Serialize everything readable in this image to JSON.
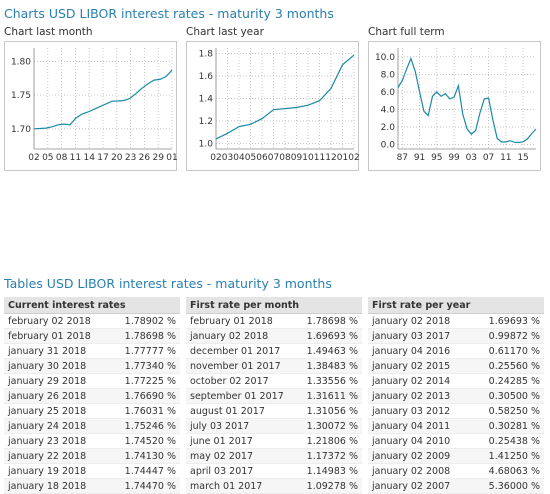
{
  "page": {
    "charts_heading": "Charts USD LIBOR interest rates - maturity 3 months",
    "tables_heading": "Tables USD LIBOR interest rates - maturity 3 months"
  },
  "colors": {
    "heading": "#2a7fb2",
    "line": "#1b8aa6",
    "grid": "#bbbbbb"
  },
  "chart_data": [
    {
      "type": "line",
      "title": "Chart last month",
      "x": [
        "02",
        "03",
        "04",
        "05",
        "08",
        "09",
        "10",
        "11",
        "12",
        "15",
        "16",
        "17",
        "18",
        "19",
        "22",
        "23",
        "24",
        "25",
        "26",
        "29",
        "30",
        "31",
        "01",
        "02"
      ],
      "xticks": [
        "02",
        "05",
        "08",
        "11",
        "14",
        "17",
        "20",
        "23",
        "26",
        "29",
        "01"
      ],
      "ylim": [
        1.67,
        1.82
      ],
      "yticks": [
        {
          "v": 1.7,
          "label": "1.70"
        },
        {
          "v": 1.75,
          "label": "1.75"
        },
        {
          "v": 1.8,
          "label": "1.80"
        }
      ],
      "values": [
        1.7,
        1.7005,
        1.701,
        1.703,
        1.706,
        1.707,
        1.706,
        1.716,
        1.722,
        1.725,
        1.729,
        1.733,
        1.737,
        1.741,
        1.7413,
        1.742,
        1.7452,
        1.7525,
        1.7603,
        1.7669,
        1.7723,
        1.7734,
        1.7777,
        1.787
      ]
    },
    {
      "type": "line",
      "title": "Chart last year",
      "x": [
        "2017-02",
        "2017-03",
        "2017-04",
        "2017-05",
        "2017-06",
        "2017-07",
        "2017-08",
        "2017-09",
        "2017-10",
        "2017-11",
        "2017-12",
        "2018-01",
        "2018-02"
      ],
      "xticks": [
        "02",
        "03",
        "04",
        "05",
        "06",
        "07",
        "08",
        "09",
        "10",
        "11",
        "12",
        "01",
        "02"
      ],
      "ylim": [
        0.95,
        1.85
      ],
      "yticks": [
        {
          "v": 1.0,
          "label": "1.0"
        },
        {
          "v": 1.2,
          "label": "1.2"
        },
        {
          "v": 1.4,
          "label": "1.4"
        },
        {
          "v": 1.6,
          "label": "1.6"
        },
        {
          "v": 1.8,
          "label": "1.8"
        }
      ],
      "values": [
        1.04,
        1.09,
        1.15,
        1.17,
        1.22,
        1.3,
        1.31,
        1.32,
        1.34,
        1.38,
        1.49,
        1.7,
        1.787
      ]
    },
    {
      "type": "line",
      "title": "Chart full term",
      "x": [
        1986,
        1987,
        1988,
        1989,
        1990,
        1991,
        1992,
        1993,
        1994,
        1995,
        1996,
        1997,
        1998,
        1999,
        2000,
        2001,
        2002,
        2003,
        2004,
        2005,
        2006,
        2007,
        2008,
        2009,
        2010,
        2011,
        2012,
        2013,
        2014,
        2015,
        2016,
        2017,
        2018
      ],
      "xticks": [
        {
          "v": 1987,
          "label": "87"
        },
        {
          "v": 1991,
          "label": "91"
        },
        {
          "v": 1995,
          "label": "95"
        },
        {
          "v": 1999,
          "label": "99"
        },
        {
          "v": 2003,
          "label": "03"
        },
        {
          "v": 2007,
          "label": "07"
        },
        {
          "v": 2011,
          "label": "11"
        },
        {
          "v": 2015,
          "label": "15"
        }
      ],
      "ylim": [
        -0.5,
        11
      ],
      "yticks": [
        {
          "v": 0,
          "label": "0.0"
        },
        {
          "v": 2,
          "label": "2.0"
        },
        {
          "v": 4,
          "label": "4.0"
        },
        {
          "v": 6,
          "label": "6.0"
        },
        {
          "v": 8,
          "label": "8.0"
        },
        {
          "v": 10,
          "label": "10.0"
        }
      ],
      "values": [
        6.5,
        7.3,
        8.6,
        9.8,
        8.3,
        6.0,
        3.8,
        3.3,
        5.5,
        6.0,
        5.5,
        5.8,
        5.2,
        5.4,
        6.7,
        3.5,
        1.8,
        1.2,
        1.6,
        3.6,
        5.2,
        5.3,
        2.8,
        0.7,
        0.3,
        0.3,
        0.45,
        0.27,
        0.24,
        0.32,
        0.65,
        1.25,
        1.78
      ]
    }
  ],
  "tables": [
    {
      "header": "Current interest rates",
      "rows": [
        [
          "february 02 2018",
          "1.78902 %"
        ],
        [
          "february 01 2018",
          "1.78698 %"
        ],
        [
          "january 31 2018",
          "1.77777 %"
        ],
        [
          "january 30 2018",
          "1.77340 %"
        ],
        [
          "january 29 2018",
          "1.77225 %"
        ],
        [
          "january 26 2018",
          "1.76690 %"
        ],
        [
          "january 25 2018",
          "1.76031 %"
        ],
        [
          "january 24 2018",
          "1.75246 %"
        ],
        [
          "january 23 2018",
          "1.74520 %"
        ],
        [
          "january 22 2018",
          "1.74130 %"
        ],
        [
          "january 19 2018",
          "1.74447 %"
        ],
        [
          "january 18 2018",
          "1.74470 %"
        ]
      ]
    },
    {
      "header": "First rate per month",
      "rows": [
        [
          "february 01 2018",
          "1.78698 %"
        ],
        [
          "january 02 2018",
          "1.69693 %"
        ],
        [
          "december 01 2017",
          "1.49463 %"
        ],
        [
          "november 01 2017",
          "1.38483 %"
        ],
        [
          "october 02 2017",
          "1.33556 %"
        ],
        [
          "september 01 2017",
          "1.31611 %"
        ],
        [
          "august 01 2017",
          "1.31056 %"
        ],
        [
          "july 03 2017",
          "1.30072 %"
        ],
        [
          "june 01 2017",
          "1.21806 %"
        ],
        [
          "may 02 2017",
          "1.17372 %"
        ],
        [
          "april 03 2017",
          "1.14983 %"
        ],
        [
          "march 01 2017",
          "1.09278 %"
        ]
      ]
    },
    {
      "header": "First rate per year",
      "rows": [
        [
          "january 02 2018",
          "1.69693 %"
        ],
        [
          "january 03 2017",
          "0.99872 %"
        ],
        [
          "january 04 2016",
          "0.61170 %"
        ],
        [
          "january 02 2015",
          "0.25560 %"
        ],
        [
          "january 02 2014",
          "0.24285 %"
        ],
        [
          "january 02 2013",
          "0.30500 %"
        ],
        [
          "january 03 2012",
          "0.58250 %"
        ],
        [
          "january 04 2011",
          "0.30281 %"
        ],
        [
          "january 04 2010",
          "0.25438 %"
        ],
        [
          "january 02 2009",
          "1.41250 %"
        ],
        [
          "january 02 2008",
          "4.68063 %"
        ],
        [
          "january 02 2007",
          "5.36000 %"
        ]
      ]
    }
  ]
}
